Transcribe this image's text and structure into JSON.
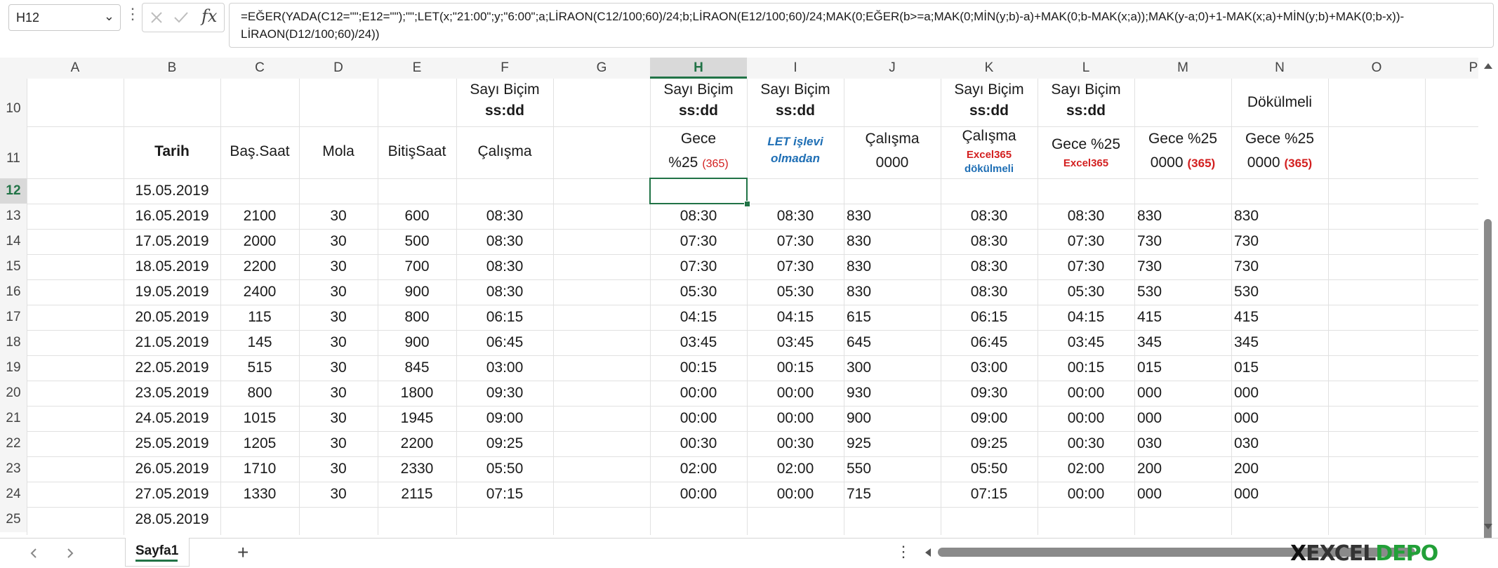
{
  "formula_bar": {
    "name_box": "H12",
    "fx_label": "fx",
    "formula": "=EĞER(YADA(C12=\"\";E12=\"\");\"\";LET(x;\"21:00\";y;\"6:00\";a;LİRAON(C12/100;60)/24;b;LİRAON(E12/100;60)/24;MAK(0;EĞER(b>=a;MAK(0;MİN(y;b)-a)+MAK(0;b-MAK(x;a));MAK(y-a;0)+1-MAK(x;a)+MİN(y;b)+MAK(0;b-x))-LİRAON(D12/100;60)/24))"
  },
  "columns": [
    "A",
    "B",
    "C",
    "D",
    "E",
    "F",
    "G",
    "H",
    "I",
    "J",
    "K",
    "L",
    "M",
    "N",
    "O",
    "P"
  ],
  "rows": [
    "10",
    "11",
    "12",
    "13",
    "14",
    "15",
    "16",
    "17",
    "18",
    "19",
    "20",
    "21",
    "22",
    "23",
    "24",
    "25"
  ],
  "selected_cell": "H12",
  "headers": {
    "row10": {
      "F": [
        "Sayı Biçim",
        "ss:dd"
      ],
      "H": [
        "Sayı Biçim",
        "ss:dd"
      ],
      "I": [
        "Sayı Biçim",
        "ss:dd"
      ],
      "K": [
        "Sayı Biçim",
        "ss:dd"
      ],
      "L": [
        "Sayı Biçim",
        "ss:dd"
      ],
      "N": "Dökülmeli"
    },
    "row11": {
      "B": "Tarih",
      "C": "Baş.Saat",
      "D": "Mola",
      "E": "BitişSaat",
      "F": "Çalışma",
      "H": {
        "line1": "Gece",
        "line2": "%25",
        "note": "(365)"
      },
      "I": {
        "line1": "LET işlevi",
        "line2": "olmadan"
      },
      "J": {
        "line1": "Çalışma",
        "line2": "0000"
      },
      "K": {
        "line1": "Çalışma",
        "line2": "Excel365",
        "line3": "dökülmeli"
      },
      "L": {
        "line1": "Gece %25",
        "line2": "Excel365"
      },
      "M": {
        "line1": "Gece %25",
        "line2": "0000",
        "note": "(365)"
      },
      "N": {
        "line1": "Gece %25",
        "line2": "0000",
        "note": "(365)"
      }
    }
  },
  "data_rows": [
    {
      "row": "12",
      "B": "15.05.2019",
      "C": "",
      "D": "",
      "E": "",
      "F": "",
      "H": "",
      "I": "",
      "J": "",
      "K": "",
      "L": "",
      "M": "",
      "N": ""
    },
    {
      "row": "13",
      "B": "16.05.2019",
      "C": "2100",
      "D": "30",
      "E": "600",
      "F": "08:30",
      "H": "08:30",
      "I": "08:30",
      "J": "830",
      "K": "08:30",
      "L": "08:30",
      "M": "830",
      "N": "830"
    },
    {
      "row": "14",
      "B": "17.05.2019",
      "C": "2000",
      "D": "30",
      "E": "500",
      "F": "08:30",
      "H": "07:30",
      "I": "07:30",
      "J": "830",
      "K": "08:30",
      "L": "07:30",
      "M": "730",
      "N": "730"
    },
    {
      "row": "15",
      "B": "18.05.2019",
      "C": "2200",
      "D": "30",
      "E": "700",
      "F": "08:30",
      "H": "07:30",
      "I": "07:30",
      "J": "830",
      "K": "08:30",
      "L": "07:30",
      "M": "730",
      "N": "730"
    },
    {
      "row": "16",
      "B": "19.05.2019",
      "C": "2400",
      "D": "30",
      "E": "900",
      "F": "08:30",
      "H": "05:30",
      "I": "05:30",
      "J": "830",
      "K": "08:30",
      "L": "05:30",
      "M": "530",
      "N": "530"
    },
    {
      "row": "17",
      "B": "20.05.2019",
      "C": "115",
      "D": "30",
      "E": "800",
      "F": "06:15",
      "H": "04:15",
      "I": "04:15",
      "J": "615",
      "K": "06:15",
      "L": "04:15",
      "M": "415",
      "N": "415"
    },
    {
      "row": "18",
      "B": "21.05.2019",
      "C": "145",
      "D": "30",
      "E": "900",
      "F": "06:45",
      "H": "03:45",
      "I": "03:45",
      "J": "645",
      "K": "06:45",
      "L": "03:45",
      "M": "345",
      "N": "345"
    },
    {
      "row": "19",
      "B": "22.05.2019",
      "C": "515",
      "D": "30",
      "E": "845",
      "F": "03:00",
      "H": "00:15",
      "I": "00:15",
      "J": "300",
      "K": "03:00",
      "L": "00:15",
      "M": "015",
      "N": "015"
    },
    {
      "row": "20",
      "B": "23.05.2019",
      "C": "800",
      "D": "30",
      "E": "1800",
      "F": "09:30",
      "H": "00:00",
      "I": "00:00",
      "J": "930",
      "K": "09:30",
      "L": "00:00",
      "M": "000",
      "N": "000"
    },
    {
      "row": "21",
      "B": "24.05.2019",
      "C": "1015",
      "D": "30",
      "E": "1945",
      "F": "09:00",
      "H": "00:00",
      "I": "00:00",
      "J": "900",
      "K": "09:00",
      "L": "00:00",
      "M": "000",
      "N": "000"
    },
    {
      "row": "22",
      "B": "25.05.2019",
      "C": "1205",
      "D": "30",
      "E": "2200",
      "F": "09:25",
      "H": "00:30",
      "I": "00:30",
      "J": "925",
      "K": "09:25",
      "L": "00:30",
      "M": "030",
      "N": "030"
    },
    {
      "row": "23",
      "B": "26.05.2019",
      "C": "1710",
      "D": "30",
      "E": "2330",
      "F": "05:50",
      "H": "02:00",
      "I": "02:00",
      "J": "550",
      "K": "05:50",
      "L": "02:00",
      "M": "200",
      "N": "200"
    },
    {
      "row": "24",
      "B": "27.05.2019",
      "C": "1330",
      "D": "30",
      "E": "2115",
      "F": "07:15",
      "H": "00:00",
      "I": "00:00",
      "J": "715",
      "K": "07:15",
      "L": "00:00",
      "M": "000",
      "N": "000"
    },
    {
      "row": "25",
      "B": "28.05.2019",
      "C": "",
      "D": "",
      "E": "",
      "F": "",
      "H": "",
      "I": "",
      "J": "",
      "K": "",
      "L": "",
      "M": "",
      "N": ""
    }
  ],
  "sheet_tabs": {
    "active": "Sayfa1",
    "add": "+"
  },
  "logo": {
    "excel": "EXCEL",
    "depo": "DEPO",
    "mark": "X"
  },
  "colors": {
    "accent": "#217346",
    "note_red": "#d32020",
    "let_blue": "#1f6fb5",
    "depo_green": "#22a038"
  }
}
